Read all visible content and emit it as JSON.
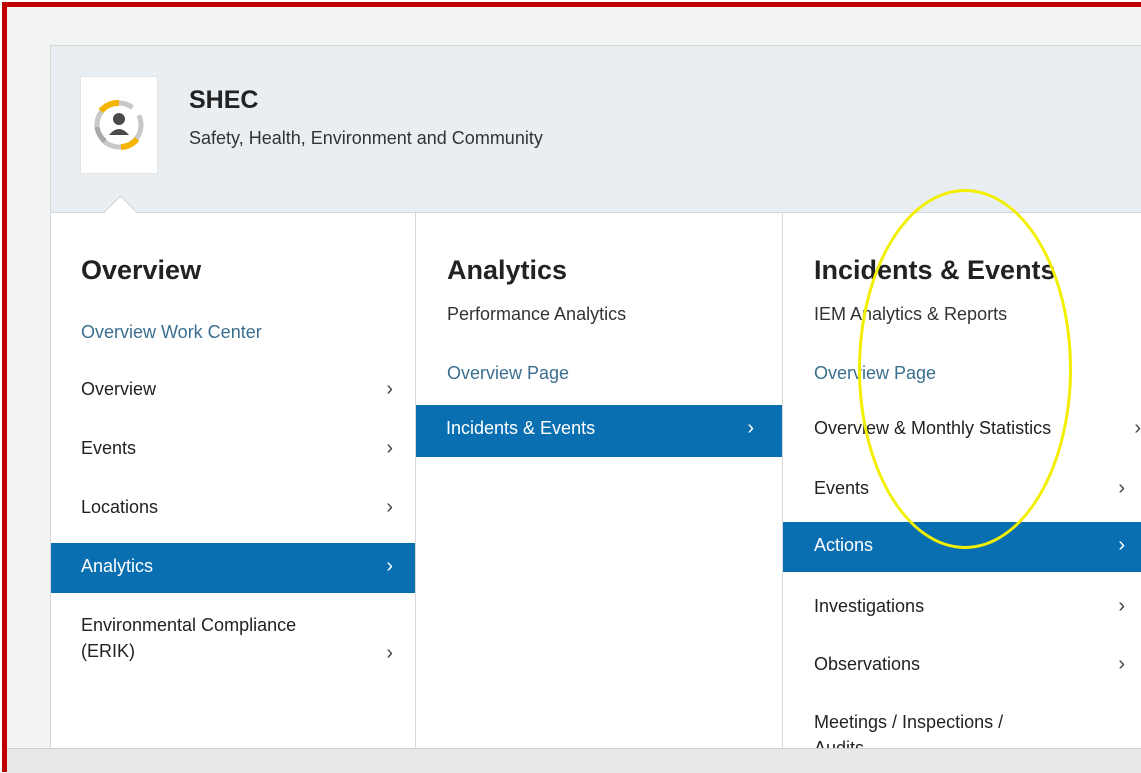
{
  "header": {
    "title": "SHEC",
    "subtitle": "Safety, Health, Environment and Community",
    "logo_icon": "person-cycle-icon",
    "logo_colors": [
      "#f4b400",
      "#e0a800",
      "#c8c8c8",
      "#888888"
    ]
  },
  "columns": [
    {
      "title": "Overview",
      "subtitle": "",
      "link": "Overview Work Center",
      "items": [
        {
          "label": "Overview",
          "active": false
        },
        {
          "label": "Events",
          "active": false
        },
        {
          "label": "Locations",
          "active": false
        },
        {
          "label": "Analytics",
          "active": true
        },
        {
          "label": "Environmental Compliance\n(ERIK)",
          "active": false
        }
      ]
    },
    {
      "title": "Analytics",
      "subtitle": "Performance Analytics",
      "link": "Overview Page",
      "items": [
        {
          "label": "Incidents & Events",
          "active": true
        }
      ]
    },
    {
      "title": "Incidents & Events",
      "subtitle": "IEM Analytics & Reports",
      "link": "Overview Page",
      "items": [
        {
          "label": "Overview & Monthly Statistics",
          "active": false
        },
        {
          "label": "Events",
          "active": false
        },
        {
          "label": "Actions",
          "active": true
        },
        {
          "label": "Investigations",
          "active": false
        },
        {
          "label": "Observations",
          "active": false
        },
        {
          "label": "Meetings / Inspections /\nAudits",
          "active": false
        }
      ]
    }
  ],
  "chevron_glyph": "›",
  "colors": {
    "active_bg": "#0a6fb1",
    "link": "#3a6f8f",
    "frame_border": "#c00000",
    "annotation_ring": "#f2ef00"
  }
}
